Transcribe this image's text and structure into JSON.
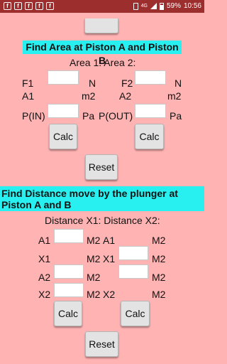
{
  "status_bar": {
    "left_icons": [
      "f",
      "f",
      "f",
      "f",
      "f"
    ],
    "network": "4G",
    "battery": "59%",
    "time": "10:56"
  },
  "top": {
    "button_label": ""
  },
  "area": {
    "heading": "Find Area at Piston A and Piston B",
    "sub_heading": "Area 1: Area 2:",
    "f1": "F1",
    "f2": "F2",
    "n1": "N",
    "n2": "N",
    "a1": "A1",
    "a2": "A2",
    "m2_1": "m2",
    "m2_2": "m2",
    "p_in": "P(IN)",
    "p_out": "P(OUT)",
    "pa1": "Pa",
    "pa2": "Pa",
    "f1_value": "",
    "f2_value": "",
    "pin_value": "",
    "pout_value": "",
    "calc1": "Calc",
    "calc2": "Calc",
    "reset": "Reset"
  },
  "distance": {
    "heading": "Find Distance move by the plunger at Piston A and B",
    "sub_heading": "Distance X1: Distance X2:",
    "left": {
      "a1": "A1",
      "m2_a1": "M2",
      "x1": "X1",
      "m2_x1": "M2",
      "a2": "A2",
      "m2_a2": "M2",
      "x2": "X2",
      "m2_x2": "M2"
    },
    "right": {
      "a1": "A1",
      "m2_a1": "M2",
      "x1": "X1",
      "m2_x1": "M2",
      "a2": "A2",
      "m2_a2": "M2",
      "x2": "X2",
      "m2_x2": "M2"
    },
    "calc1": "Calc",
    "calc2": "Calc",
    "reset": "Reset"
  }
}
